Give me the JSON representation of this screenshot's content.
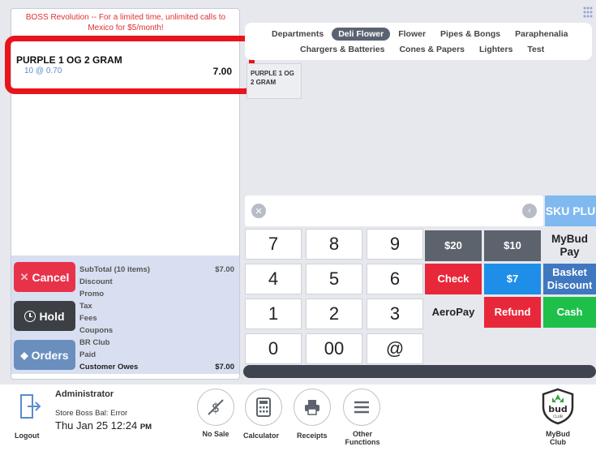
{
  "promo_banner": "BOSS Revolution -- For a limited time, unlimited calls to Mexico for $5/month!",
  "cart": {
    "item_name": "PURPLE 1 OG 2 GRAM",
    "item_qty": "10 @ 0.70",
    "item_price": "7.00"
  },
  "totals": {
    "subtotal_label": "SubTotal (10 items)",
    "subtotal_value": "$7.00",
    "discount": "Discount",
    "promo": "Promo",
    "tax": "Tax",
    "fees": "Fees",
    "coupons": "Coupons",
    "br_club": "BR Club",
    "paid": "Paid",
    "owes_label": "Customer Owes",
    "owes_value": "$7.00"
  },
  "left_buttons": {
    "cancel": "Cancel",
    "hold": "Hold",
    "orders": "Orders"
  },
  "tabs": {
    "row1": [
      "Departments",
      "Deli Flower",
      "Flower",
      "Pipes & Bongs",
      "Paraphenalia"
    ],
    "row2": [
      "Chargers & Batteries",
      "Cones & Papers",
      "Lighters",
      "Test"
    ]
  },
  "product_tile": "PURPLE 1 OG 2 GRAM",
  "sku_button": "SKU PLU",
  "keypad": [
    "7",
    "8",
    "9",
    "4",
    "5",
    "6",
    "1",
    "2",
    "3",
    "0",
    "00",
    "@"
  ],
  "payments": {
    "p20": "$20",
    "p10": "$10",
    "mybud_pay": "MyBud Pay",
    "check": "Check",
    "p7": "$7",
    "basket_discount": "Basket Discount",
    "aeropay": "AeroPay",
    "refund": "Refund",
    "cash": "Cash"
  },
  "footer": {
    "user": "Administrator",
    "store_bal": "Store Boss Bal: Error",
    "datetime": "Thu Jan 25 12:24",
    "ampm": "PM",
    "logout": "Logout",
    "no_sale": "No Sale",
    "calculator": "Calculator",
    "receipts": "Receipts",
    "other_functions": "Other Functions",
    "mybud_club": "MyBud Club",
    "logo_text": "bud",
    "logo_sub": "CLUB"
  },
  "colors": {
    "cancel": "#e8324a",
    "hold": "#3c3f44",
    "orders": "#6a8fbf",
    "check": "#e8283a",
    "refund": "#e8283a",
    "cash": "#1fc04a",
    "blue": "#1e8ee8",
    "basket": "#3f78c0",
    "dark_gray": "#5d636d",
    "highlight": "#e8141a"
  }
}
